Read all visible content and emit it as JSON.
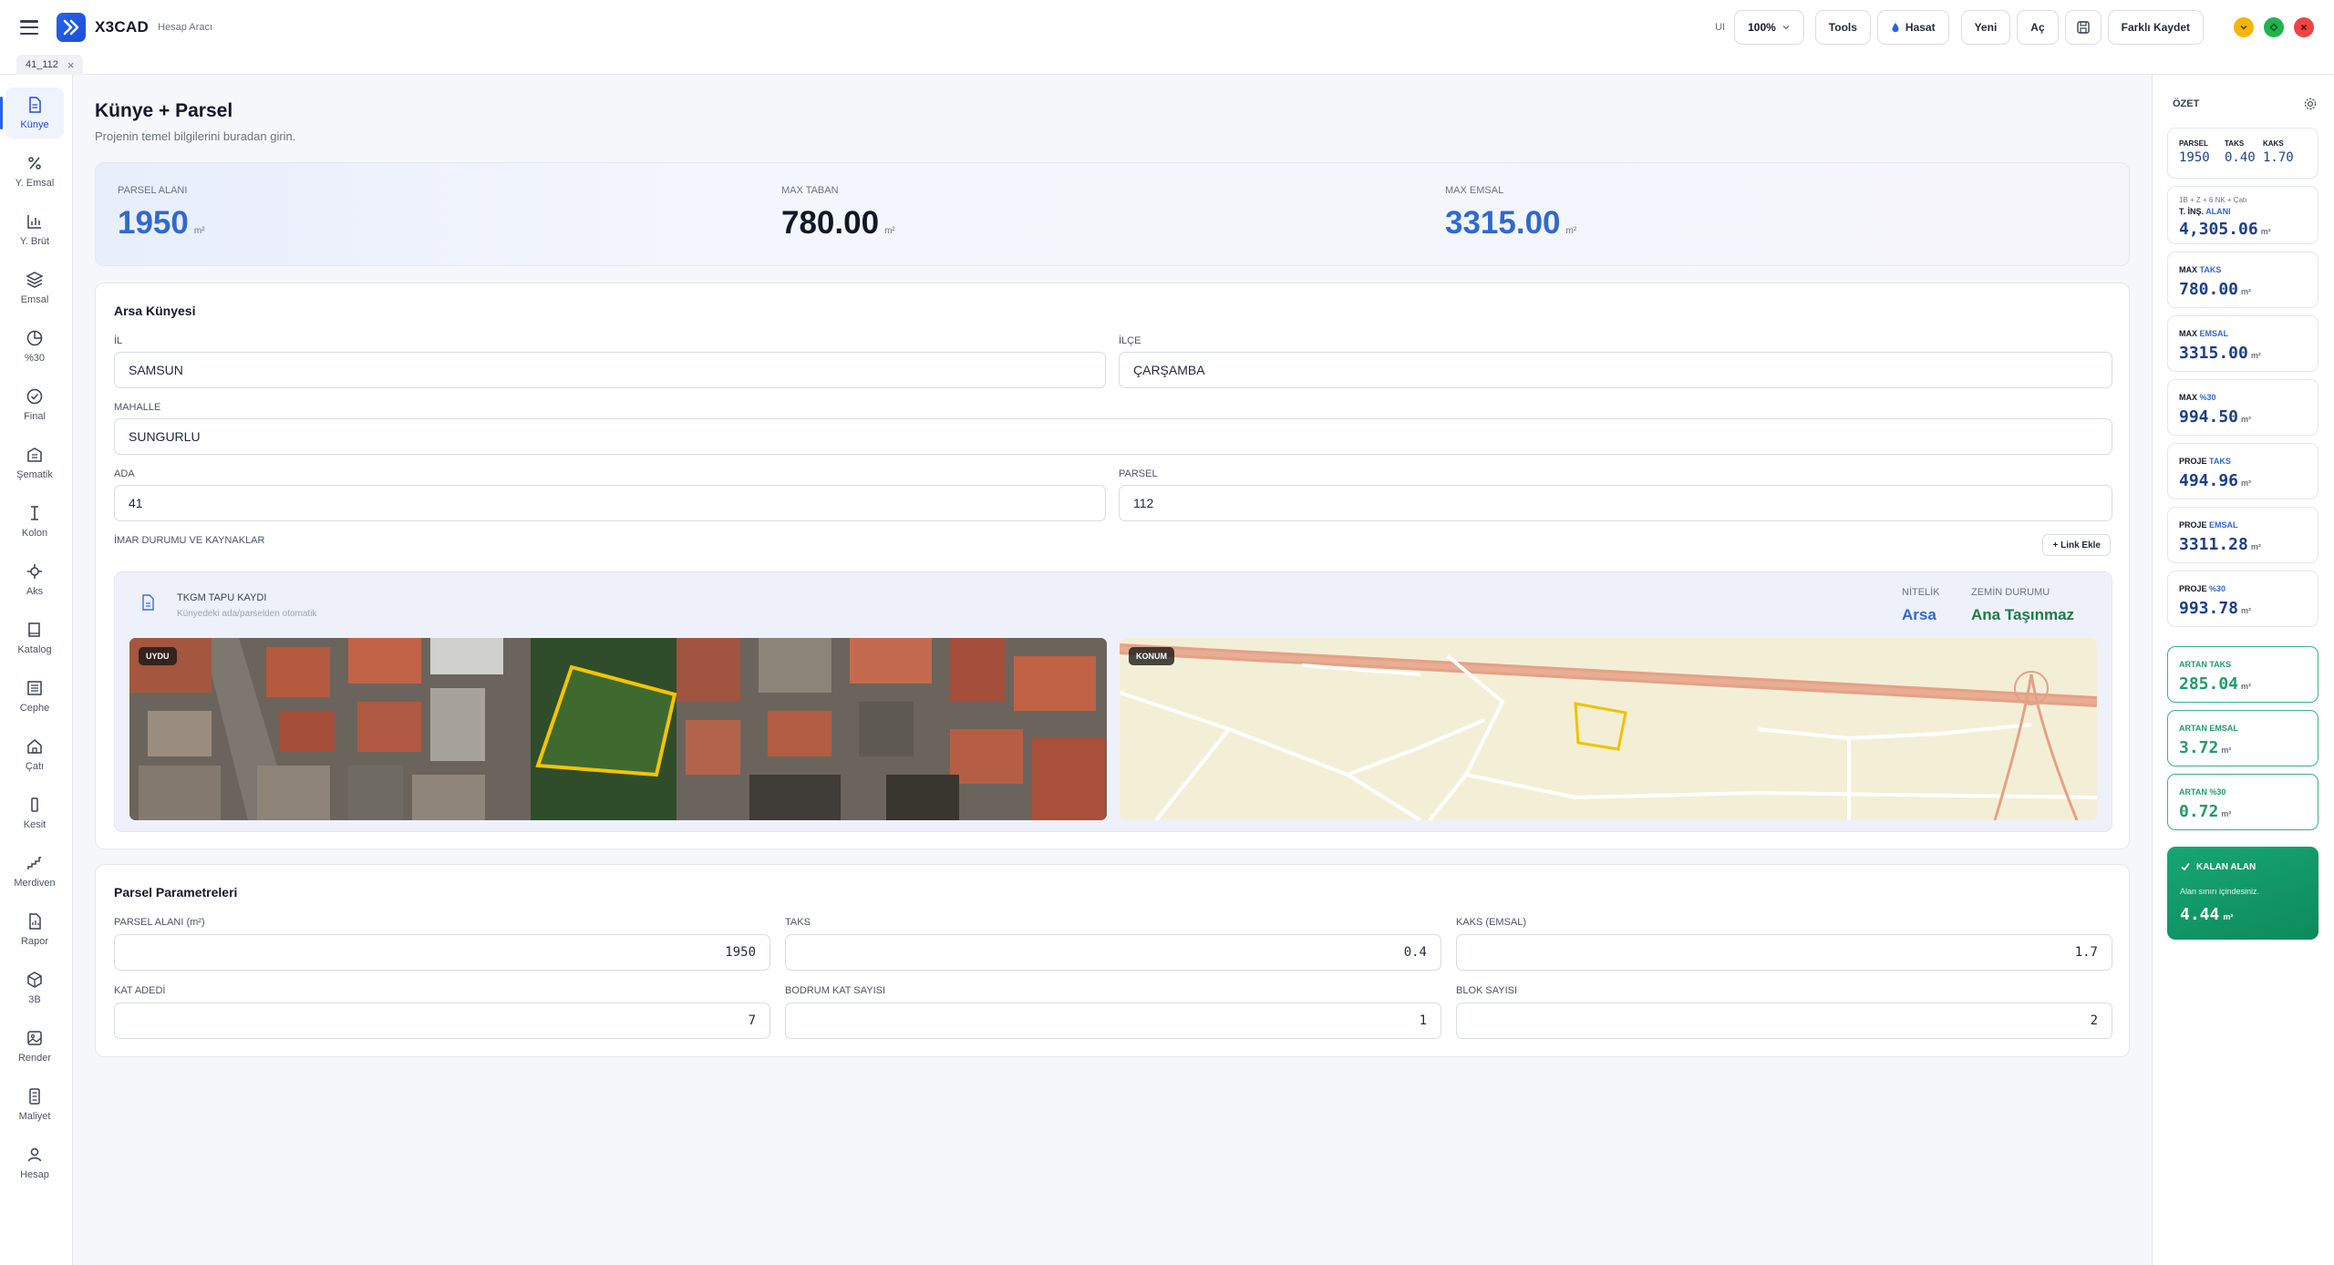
{
  "app": {
    "name": "X3CAD",
    "subtitle": "Hesap Aracı"
  },
  "toolbar": {
    "ui_label": "UI",
    "zoom": "100%",
    "tools": "Tools",
    "hasat": "Hasat",
    "yeni": "Yeni",
    "ac": "Aç",
    "farkli_kaydet": "Farklı Kaydet"
  },
  "tab": {
    "label": "41_112",
    "close": "×"
  },
  "nav": [
    {
      "label": "Künye",
      "icon": "document-icon"
    },
    {
      "label": "Y. Emsal",
      "icon": "percent-icon"
    },
    {
      "label": "Y. Brüt",
      "icon": "bar-chart-icon"
    },
    {
      "label": "Emsal",
      "icon": "layers-icon"
    },
    {
      "label": "%30",
      "icon": "pie-icon"
    },
    {
      "label": "Final",
      "icon": "check-circle-icon"
    },
    {
      "label": "Şematik",
      "icon": "building-icon"
    },
    {
      "label": "Kolon",
      "icon": "column-icon"
    },
    {
      "label": "Aks",
      "icon": "crosshair-icon"
    },
    {
      "label": "Katalog",
      "icon": "book-icon"
    },
    {
      "label": "Cephe",
      "icon": "facade-icon"
    },
    {
      "label": "Çatı",
      "icon": "home-icon"
    },
    {
      "label": "Kesit",
      "icon": "section-icon"
    },
    {
      "label": "Merdiven",
      "icon": "stairs-icon"
    },
    {
      "label": "Rapor",
      "icon": "report-icon"
    },
    {
      "label": "3B",
      "icon": "cube-icon"
    },
    {
      "label": "Render",
      "icon": "image-icon"
    },
    {
      "label": "Maliyet",
      "icon": "calculator-icon"
    },
    {
      "label": "Hesap",
      "icon": "user-icon"
    }
  ],
  "page": {
    "title": "Künye + Parsel",
    "subtitle": "Projenin temel bilgilerini buradan girin."
  },
  "stats": [
    {
      "label": "PARSEL ALANI",
      "value": "1950",
      "unit": "m²"
    },
    {
      "label": "MAX TABAN",
      "value": "780.00",
      "unit": "m²"
    },
    {
      "label": "MAX EMSAL",
      "value": "3315.00",
      "unit": "m²"
    }
  ],
  "arsa": {
    "title": "Arsa Künyesi",
    "il_label": "İL",
    "il_value": "SAMSUN",
    "ilce_label": "İLÇE",
    "ilce_value": "ÇARŞAMBA",
    "mahalle_label": "MAHALLE",
    "mahalle_value": "SUNGURLU",
    "ada_label": "ADA",
    "ada_value": "41",
    "parsel_label": "PARSEL",
    "parsel_value": "112",
    "imar_label": "İMAR DURUMU VE KAYNAKLAR",
    "link_button": "+ Link Ekle"
  },
  "tapu": {
    "title": "TKGM TAPU KAYDI",
    "subtitle": "Künyedeki ada/parselden otomatik",
    "nitelik_label": "NİTELİK",
    "nitelik_value": "Arsa",
    "zemin_label": "ZEMİN DURUMU",
    "zemin_value": "Ana Taşınmaz",
    "uydu_badge": "UYDU",
    "konum_badge": "KONUM"
  },
  "params": {
    "title": "Parsel Parametreleri",
    "fields": [
      {
        "label": "PARSEL ALANI (m²)",
        "value": "1950"
      },
      {
        "label": "TAKS",
        "value": "0.4"
      },
      {
        "label": "KAKS (EMSAL)",
        "value": "1.7"
      },
      {
        "label": "KAT ADEDİ",
        "value": "7"
      },
      {
        "label": "BODRUM KAT SAYISI",
        "value": "1"
      },
      {
        "label": "BLOK SAYISI",
        "value": "2"
      }
    ]
  },
  "summary": {
    "title": "ÖZET",
    "top": {
      "parsel_label": "PARSEL",
      "parsel": "1950",
      "taks_label": "TAKS",
      "taks": "0.40",
      "kaks_label": "KAKS",
      "kaks": "1.70"
    },
    "ins": {
      "note": "1B + Z + 6 NK + Çatı",
      "label_a": "T. İNŞ.",
      "label_b": "ALANI",
      "value": "4,305.06",
      "unit": "m²"
    },
    "cards": [
      {
        "a": "MAX",
        "b": "TAKS",
        "value": "780.00",
        "unit": "m²"
      },
      {
        "a": "MAX",
        "b": "EMSAL",
        "value": "3315.00",
        "unit": "m²"
      },
      {
        "a": "MAX",
        "b": "%30",
        "value": "994.50",
        "unit": "m²"
      },
      {
        "a": "PROJE",
        "b": "TAKS",
        "value": "494.96",
        "unit": "m²"
      },
      {
        "a": "PROJE",
        "b": "EMSAL",
        "value": "3311.28",
        "unit": "m²"
      },
      {
        "a": "PROJE",
        "b": "%30",
        "value": "993.78",
        "unit": "m²"
      }
    ],
    "green_cards": [
      {
        "a": "ARTAN",
        "b": "TAKS",
        "value": "285.04",
        "unit": "m²"
      },
      {
        "a": "ARTAN",
        "b": "EMSAL",
        "value": "3.72",
        "unit": "m²"
      },
      {
        "a": "ARTAN",
        "b": "%30",
        "value": "0.72",
        "unit": "m²"
      }
    ],
    "kalan": {
      "title": "KALAN ALAN",
      "text": "Alan sınırı içindesiniz.",
      "value": "4.44",
      "unit": "m²"
    }
  },
  "colors": {
    "accent": "#2563eb",
    "stat_blue": "#2f69d1",
    "green": "#1f9d6b",
    "tapu_green": "#1f7a4a"
  }
}
